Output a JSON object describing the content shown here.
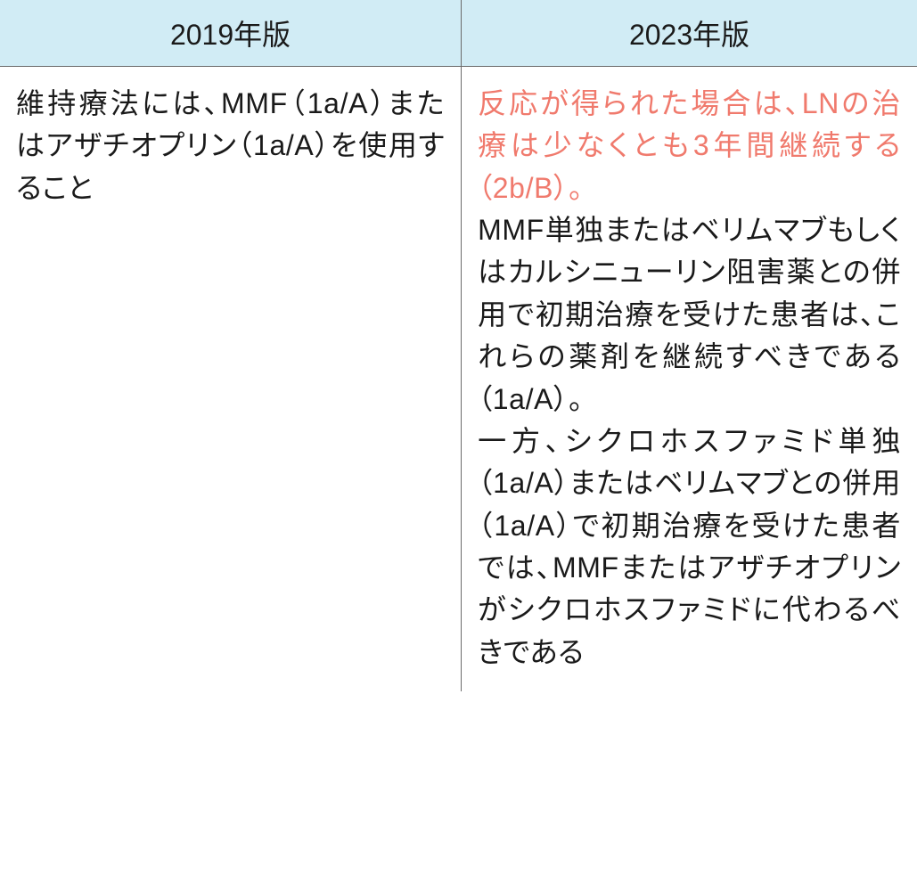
{
  "table": {
    "header": {
      "col1": "2019年版",
      "col2": "2023年版"
    },
    "row": {
      "left": "維持療法には、MMF（1a/A）またはアザチオプリン（1a/A）を使用すること",
      "right_highlight": "反応が得られた場合は、LNの治療は少なくとも3年間継続する（2b/B）。",
      "right_plain": "MMF単独またはベリムマブもしくはカルシニューリン阻害薬との併用で初期治療を受けた患者は、これらの薬剤を継続すべきである（1a/A）。\n一方、シクロホスファミド単独（1a/A）またはベリムマブとの併用（1a/A）で初期治療を受けた患者では、MMFまたはアザチオプリンがシクロホスファミドに代わるべきである"
    }
  }
}
